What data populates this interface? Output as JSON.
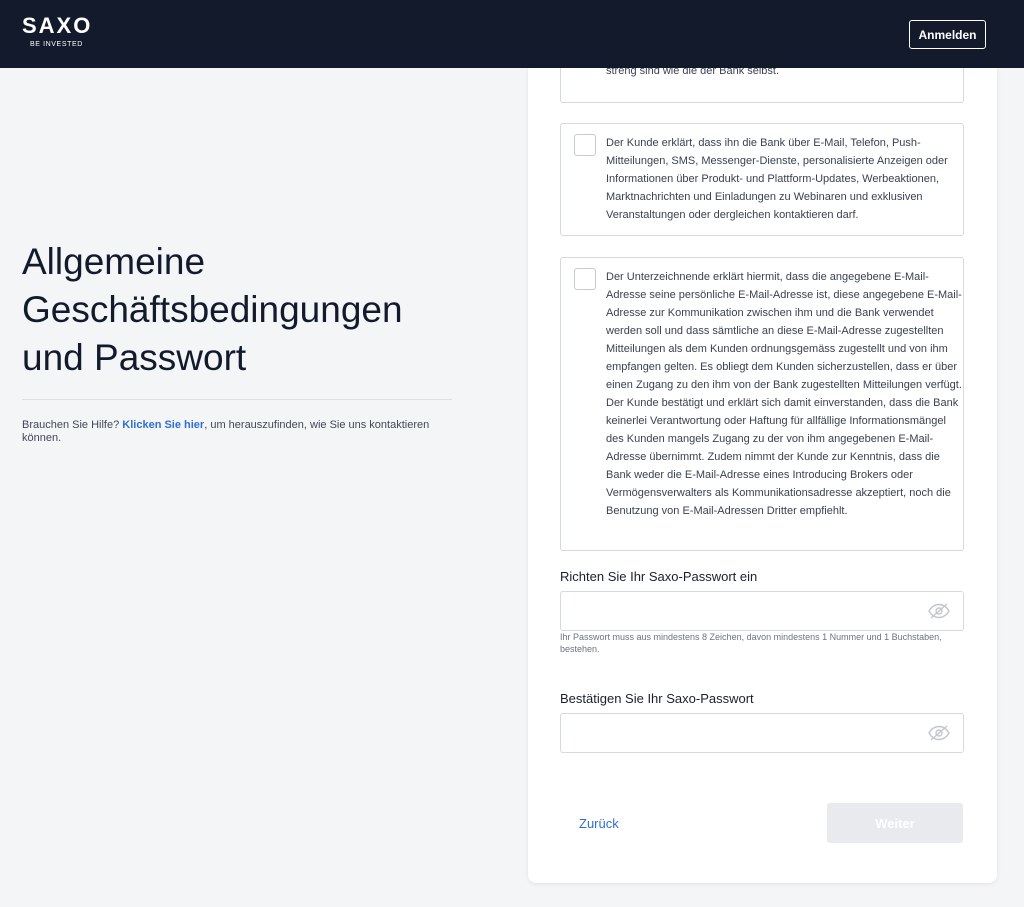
{
  "header": {
    "logo_main": "SAXO",
    "logo_sub": "BE INVESTED",
    "login_label": "Anmelden"
  },
  "left": {
    "title_lines": [
      "Allgemeine",
      "Geschäftsbedingungen",
      "und Passwort"
    ],
    "help_prefix": "Brauchen Sie Hilfe? ",
    "help_link": "Klicken Sie hier",
    "help_suffix": ", um herauszufinden, wie Sie uns kontaktieren können."
  },
  "consents": [
    {
      "text": "streng sind wie die der Bank selbst.",
      "checked": false
    },
    {
      "text": "Der Kunde erklärt, dass ihn die Bank über E-Mail, Telefon, Push-Mitteilungen, SMS, Messenger-Dienste, personalisierte Anzeigen oder Informationen über Produkt- und Plattform-Updates, Werbeaktionen, Marktnachrichten und Einladungen zu Webinaren und exklusiven Veranstaltungen oder dergleichen kontaktieren darf.",
      "checked": false
    },
    {
      "text": "Der Unterzeichnende erklärt hiermit, dass die angegebene E-Mail-Adresse seine persönliche E-Mail-Adresse ist, diese angegebene E-Mail-Adresse zur Kommunikation zwischen ihm und die Bank verwendet werden soll und dass sämtliche an diese E-Mail-Adresse zugestellten Mitteilungen als dem Kunden ordnungsgemäss zugestellt und von ihm empfangen gelten. Es obliegt dem Kunden sicherzustellen, dass er über einen Zugang zu den ihm von der Bank zugestellten Mitteilungen verfügt. Der Kunde bestätigt und erklärt sich damit einverstanden, dass die Bank keinerlei Verantwortung oder Haftung für allfällige Informationsmängel des Kunden mangels Zugang zu der von ihm angegebenen E-Mail-Adresse übernimmt. Zudem nimmt der Kunde zur Kenntnis, dass die Bank weder die E-Mail-Adresse eines Introducing Brokers oder Vermögensverwalters als Kommunikationsadresse akzeptiert, noch die Benutzung von E-Mail-Adressen Dritter empfiehlt.",
      "checked": false
    }
  ],
  "password": {
    "label": "Richten Sie Ihr Saxo-Passwort ein",
    "value": "",
    "hint": "Ihr Passwort muss aus mindestens 8 Zeichen, davon mindestens 1 Nummer und 1 Buchstaben, bestehen."
  },
  "confirm": {
    "label": "Bestätigen Sie Ihr Saxo-Passwort",
    "value": ""
  },
  "footer": {
    "back_label": "Zurück",
    "next_label": "Weiter"
  },
  "colors": {
    "header_bg": "#131a2b",
    "link": "#2f6fd1",
    "disabled_button": "#e8eaee"
  }
}
